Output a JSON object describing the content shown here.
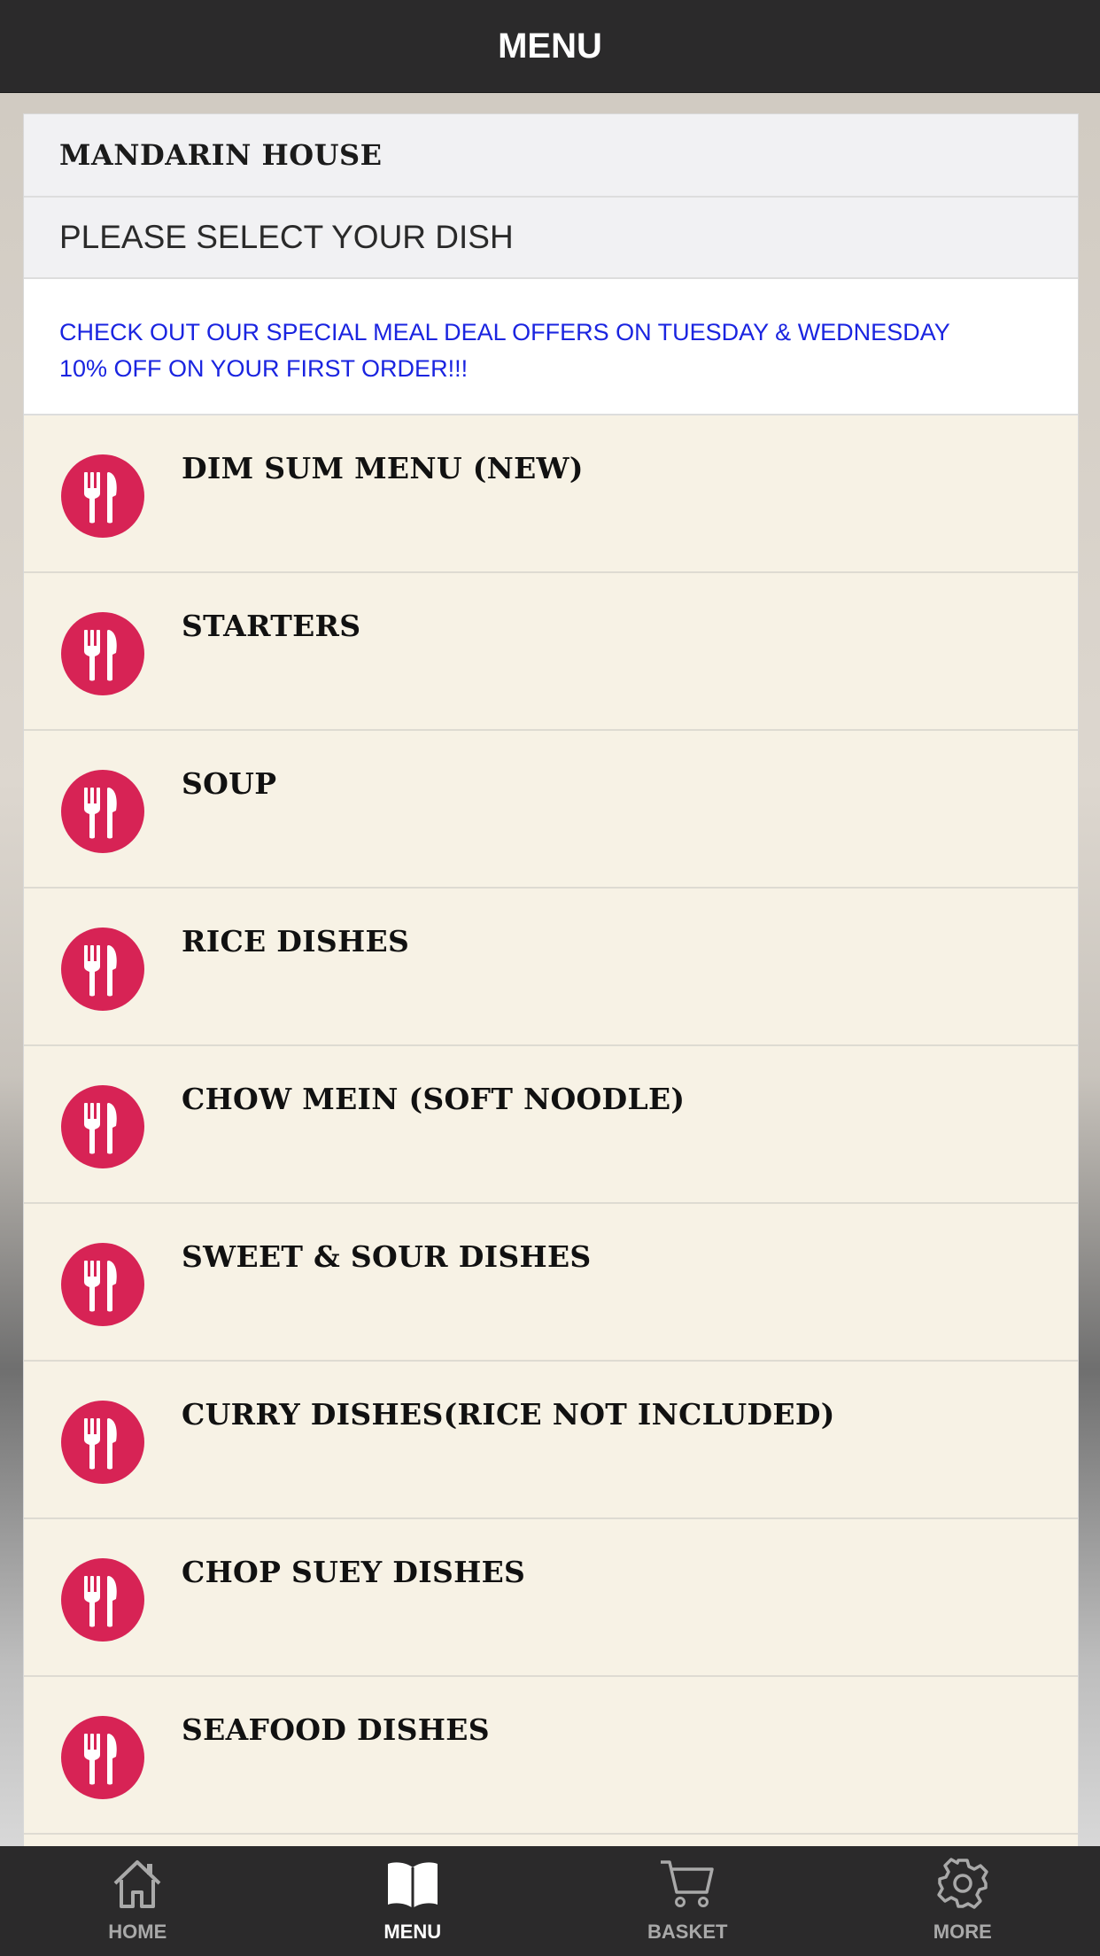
{
  "header": {
    "title": "MENU"
  },
  "restaurant": {
    "name": "MANDARIN HOUSE"
  },
  "prompt": "PLEASE SELECT YOUR DISH",
  "notice": {
    "line1": "CHECK OUT OUR SPECIAL MEAL DEAL OFFERS ON TUESDAY & WEDNESDAY",
    "line2": "10% OFF ON YOUR FIRST ORDER!!!"
  },
  "categories": [
    {
      "label": "DIM SUM MENU (NEW)"
    },
    {
      "label": "STARTERS"
    },
    {
      "label": "SOUP"
    },
    {
      "label": "RICE DISHES"
    },
    {
      "label": "CHOW MEIN (SOFT NOODLE)"
    },
    {
      "label": "SWEET & SOUR DISHES"
    },
    {
      "label": "CURRY DISHES(RICE NOT INCLUDED)"
    },
    {
      "label": "CHOP SUEY DISHES"
    },
    {
      "label": "SEAFOOD DISHES"
    }
  ],
  "tabs": [
    {
      "label": "HOME",
      "icon": "home-icon"
    },
    {
      "label": "MENU",
      "icon": "book-icon",
      "active": true
    },
    {
      "label": "BASKET",
      "icon": "cart-icon"
    },
    {
      "label": "MORE",
      "icon": "gear-icon"
    }
  ],
  "colors": {
    "accent": "#d72355",
    "notice_text": "#1a24e0",
    "bar": "#2b2a2b",
    "row_bg": "#f7f2e5"
  }
}
